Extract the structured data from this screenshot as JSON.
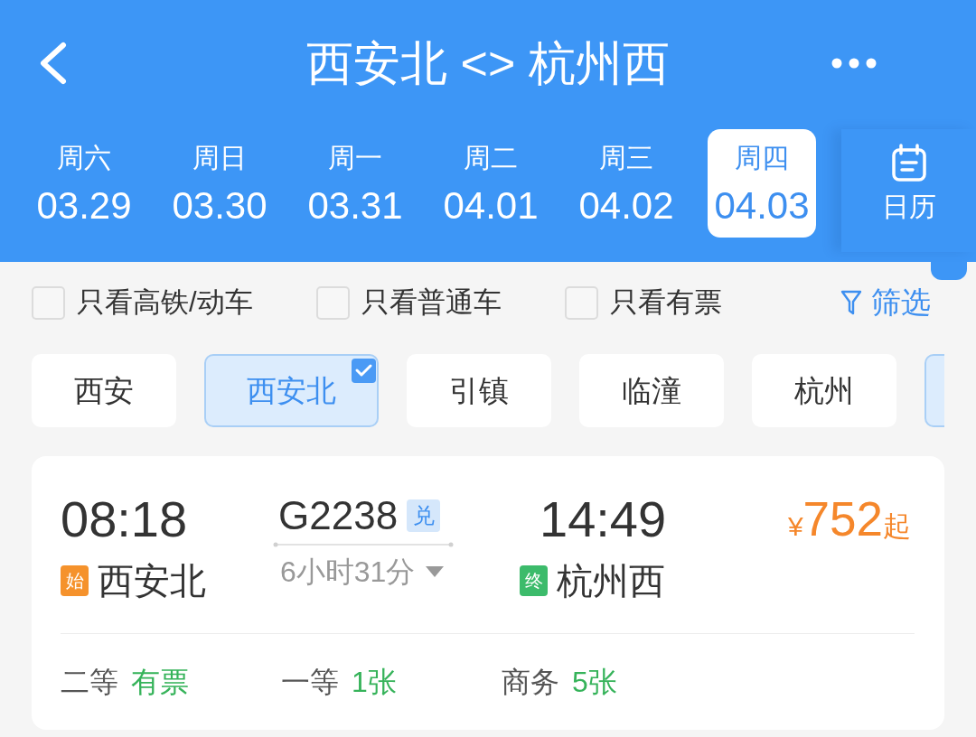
{
  "header": {
    "title": "西安北 <> 杭州西"
  },
  "date_tabs": [
    {
      "weekday": "周六",
      "date": "03.29",
      "selected": false
    },
    {
      "weekday": "周日",
      "date": "03.30",
      "selected": false
    },
    {
      "weekday": "周一",
      "date": "03.31",
      "selected": false
    },
    {
      "weekday": "周二",
      "date": "04.01",
      "selected": false
    },
    {
      "weekday": "周三",
      "date": "04.02",
      "selected": false
    },
    {
      "weekday": "周四",
      "date": "04.03",
      "selected": true
    }
  ],
  "calendar_button": {
    "label": "日历"
  },
  "filters": [
    {
      "label": "只看高铁/动车",
      "checked": false
    },
    {
      "label": "只看普通车",
      "checked": false
    },
    {
      "label": "只看有票",
      "checked": false
    }
  ],
  "filter_link": {
    "label": "筛选"
  },
  "stations": [
    {
      "label": "西安",
      "selected": false
    },
    {
      "label": "西安北",
      "selected": true
    },
    {
      "label": "引镇",
      "selected": false
    },
    {
      "label": "临潼",
      "selected": false
    },
    {
      "label": "杭州",
      "selected": false
    },
    {
      "selected": true
    }
  ],
  "trains": [
    {
      "depart_time": "08:18",
      "origin_mark": "始",
      "depart_station": "西安北",
      "train_number": "G2238",
      "exchange_mark": "兑",
      "duration": "6小时31分",
      "arrive_time": "14:49",
      "terminal_mark": "终",
      "arrive_station": "杭州西",
      "price": {
        "currency": "¥",
        "amount": "752",
        "suffix": "起"
      },
      "seats": [
        {
          "class": "二等",
          "availability": "有票"
        },
        {
          "class": "一等",
          "availability": "1张"
        },
        {
          "class": "商务",
          "availability": "5张"
        }
      ]
    }
  ]
}
